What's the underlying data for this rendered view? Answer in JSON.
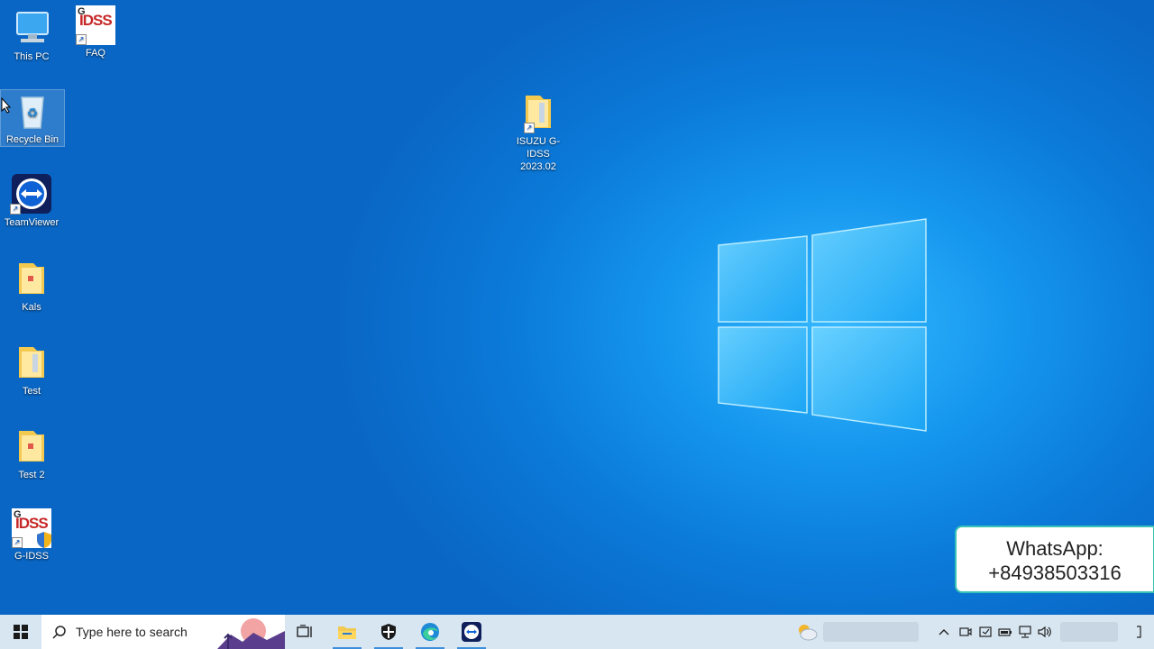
{
  "desktop": {
    "icons": [
      {
        "name": "This PC"
      },
      {
        "name": "FAQ"
      },
      {
        "name": "Recycle Bin"
      },
      {
        "name": "TeamViewer"
      },
      {
        "name": "Kals"
      },
      {
        "name": "Test"
      },
      {
        "name": "Test 2"
      },
      {
        "name": "G-IDSS"
      },
      {
        "name_line1": "ISUZU G-IDSS",
        "name_line2": "2023.02"
      }
    ],
    "idss_logo_text": "IDSS",
    "idss_logo_letter": "G"
  },
  "overlay": {
    "line1": "WhatsApp:",
    "line2": "+84938503316",
    "border_color": "#36c2b4"
  },
  "taskbar": {
    "search_placeholder": "Type here to search",
    "apps": [
      {
        "icon": "task-view-icon"
      },
      {
        "icon": "file-explorer-icon",
        "running": true
      },
      {
        "icon": "windows-security-icon",
        "running": true
      },
      {
        "icon": "edge-icon",
        "running": true
      },
      {
        "icon": "teamviewer-icon",
        "running": true
      }
    ],
    "tray_icons": [
      "weather-icon",
      "chevron-up-icon",
      "meet-now-icon",
      "action-icon",
      "battery-icon",
      "network-icon",
      "volume-icon",
      "notification-icon"
    ]
  },
  "colors": {
    "desktop_accent": "#0b7ad9",
    "taskbar": "#d8e6f2"
  }
}
